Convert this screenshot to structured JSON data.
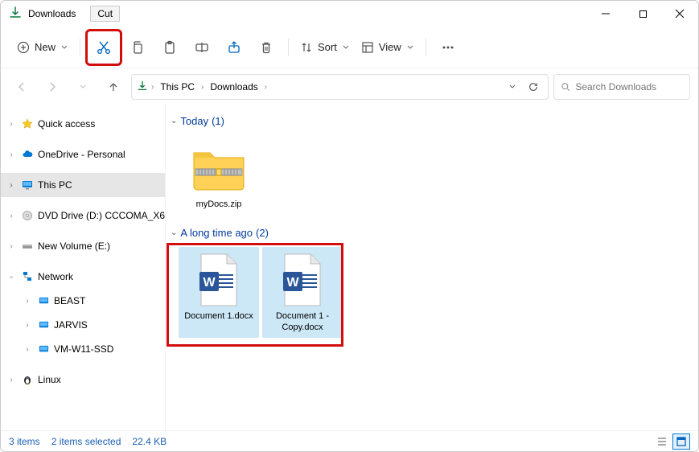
{
  "window": {
    "title": "Downloads",
    "tooltip": "Cut"
  },
  "toolbar": {
    "new_label": "New",
    "sort_label": "Sort",
    "view_label": "View"
  },
  "breadcrumb": {
    "root": "This PC",
    "current": "Downloads"
  },
  "search": {
    "placeholder": "Search Downloads"
  },
  "sidebar": {
    "quick_access": "Quick access",
    "onedrive": "OneDrive - Personal",
    "this_pc": "This PC",
    "dvd": "DVD Drive (D:) CCCOMA_X6",
    "new_volume": "New Volume (E:)",
    "network": "Network",
    "net_items": [
      "BEAST",
      "JARVIS",
      "VM-W11-SSD"
    ],
    "linux": "Linux"
  },
  "groups": {
    "today": {
      "label": "Today",
      "count": "(1)"
    },
    "long_ago": {
      "label": "A long time ago",
      "count": "(2)"
    }
  },
  "files": {
    "zip": "myDocs.zip",
    "doc1": "Document 1.docx",
    "doc2": "Document 1 - Copy.docx"
  },
  "status": {
    "items": "3 items",
    "selected": "2 items selected",
    "size": "22.4 KB"
  }
}
